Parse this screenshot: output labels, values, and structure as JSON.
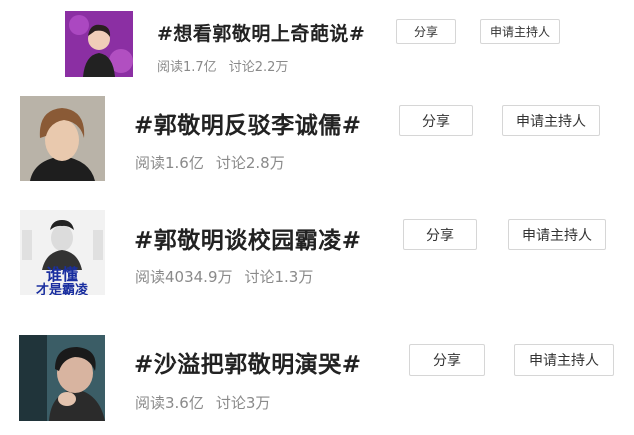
{
  "topics": [
    {
      "title": "#想看郭敬明上奇葩说#",
      "reads": "阅读1.7亿",
      "discuss": "讨论2.2万",
      "share": "分享",
      "apply": "申请主持人",
      "thumb": "person-on-stage-purple",
      "accent": "#8b2fa3"
    },
    {
      "title": "#郭敬明反驳李诚儒#",
      "reads": "阅读1.6亿",
      "discuss": "讨论2.8万",
      "share": "分享",
      "apply": "申请主持人",
      "thumb": "person-portrait-brown-hair",
      "accent": "#5a4a3a"
    },
    {
      "title": "#郭敬明谈校园霸凌#",
      "reads": "阅读4034.9万",
      "discuss": "讨论1.3万",
      "share": "分享",
      "apply": "申请主持人",
      "thumb": "poster-blue-text",
      "accent": "#1a2fa0",
      "thumb_text_1": "谁懂",
      "thumb_text_2": "才是霸凌"
    },
    {
      "title": "#沙溢把郭敬明演哭#",
      "reads": "阅读3.6亿",
      "discuss": "讨论3万",
      "share": "分享",
      "apply": "申请主持人",
      "thumb": "person-crying-teal",
      "accent": "#2f5a66"
    }
  ]
}
